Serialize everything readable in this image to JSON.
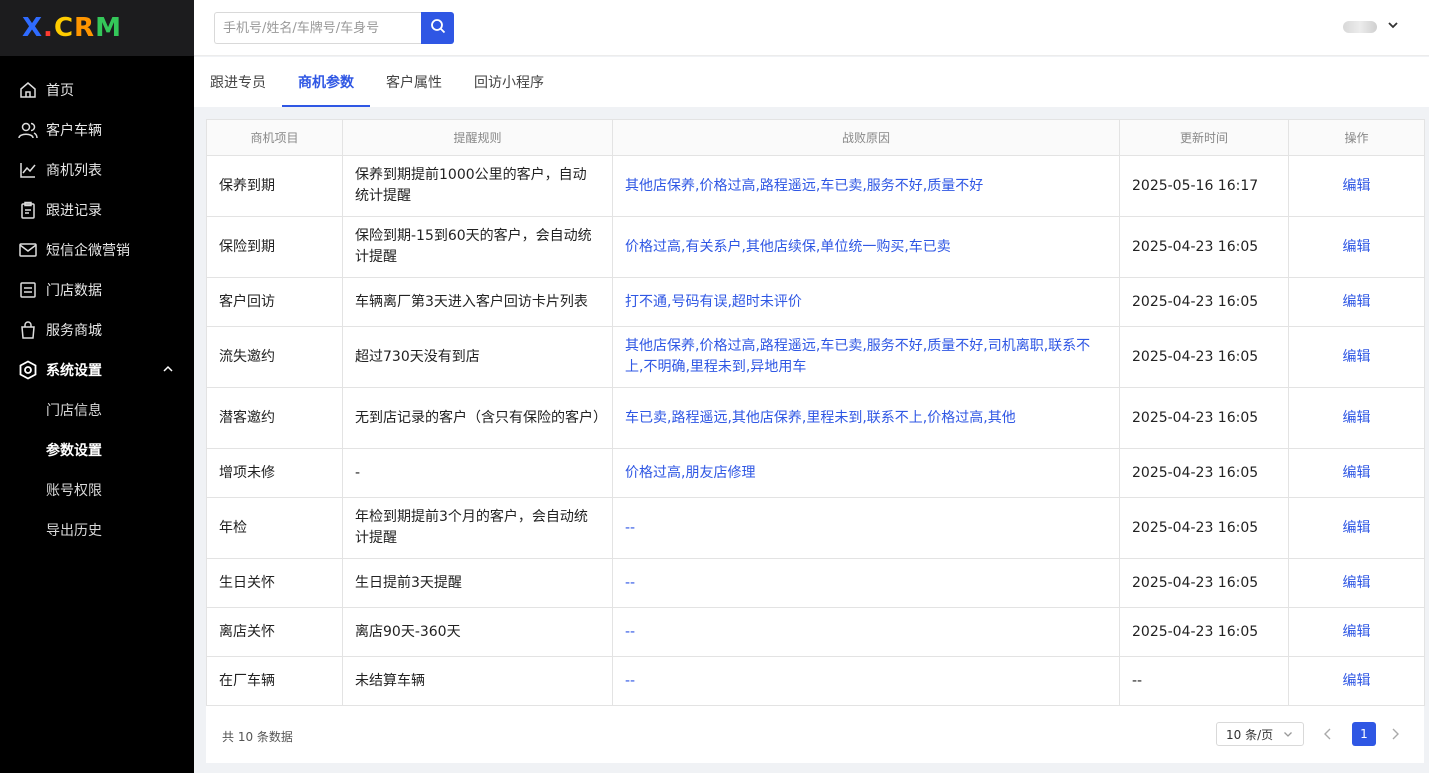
{
  "brand": {
    "logo_parts": [
      "X",
      ".",
      "C",
      "R",
      "M"
    ]
  },
  "sidebar": {
    "items": [
      {
        "label": "首页",
        "icon": "home-icon"
      },
      {
        "label": "客户车辆",
        "icon": "users-icon"
      },
      {
        "label": "商机列表",
        "icon": "chart-line-icon"
      },
      {
        "label": "跟进记录",
        "icon": "clipboard-icon"
      },
      {
        "label": "短信企微营销",
        "icon": "mail-icon"
      },
      {
        "label": "门店数据",
        "icon": "data-list-icon"
      },
      {
        "label": "服务商城",
        "icon": "shopping-bag-icon"
      },
      {
        "label": "系统设置",
        "icon": "settings-icon"
      }
    ],
    "sub_items": [
      {
        "label": "门店信息"
      },
      {
        "label": "参数设置"
      },
      {
        "label": "账号权限"
      },
      {
        "label": "导出历史"
      }
    ]
  },
  "header": {
    "search_placeholder": "手机号/姓名/车牌号/车身号"
  },
  "tabs": [
    {
      "label": "跟进专员"
    },
    {
      "label": "商机参数"
    },
    {
      "label": "客户属性"
    },
    {
      "label": "回访小程序"
    }
  ],
  "table": {
    "headers": [
      "商机项目",
      "提醒规则",
      "战败原因",
      "更新时间",
      "操作"
    ],
    "rows": [
      {
        "item": "保养到期",
        "rule": "保养到期提前1000公里的客户，自动统计提醒",
        "reason": "其他店保养,价格过高,路程遥远,车已卖,服务不好,质量不好",
        "time": "2025-05-16 16:17",
        "op": "编辑"
      },
      {
        "item": "保险到期",
        "rule": "保险到期-15到60天的客户，会自动统计提醒",
        "reason": "价格过高,有关系户,其他店续保,单位统一购买,车已卖",
        "time": "2025-04-23 16:05",
        "op": "编辑"
      },
      {
        "item": "客户回访",
        "rule": "车辆离厂第3天进入客户回访卡片列表",
        "reason": "打不通,号码有误,超时未评价",
        "time": "2025-04-23 16:05",
        "op": "编辑"
      },
      {
        "item": "流失邀约",
        "rule": "超过730天没有到店",
        "reason": "其他店保养,价格过高,路程遥远,车已卖,服务不好,质量不好,司机离职,联系不上,不明确,里程未到,异地用车",
        "time": "2025-04-23 16:05",
        "op": "编辑"
      },
      {
        "item": "潜客邀约",
        "rule": "无到店记录的客户（含只有保险的客户）",
        "reason": "车已卖,路程遥远,其他店保养,里程未到,联系不上,价格过高,其他",
        "time": "2025-04-23 16:05",
        "op": "编辑"
      },
      {
        "item": "增项未修",
        "rule": "-",
        "reason": "价格过高,朋友店修理",
        "time": "2025-04-23 16:05",
        "op": "编辑"
      },
      {
        "item": "年检",
        "rule": "年检到期提前3个月的客户，会自动统计提醒",
        "reason": "--",
        "time": "2025-04-23 16:05",
        "op": "编辑"
      },
      {
        "item": "生日关怀",
        "rule": "生日提前3天提醒",
        "reason": "--",
        "time": "2025-04-23 16:05",
        "op": "编辑"
      },
      {
        "item": "离店关怀",
        "rule": "离店90天-360天",
        "reason": "--",
        "time": "2025-04-23 16:05",
        "op": "编辑"
      },
      {
        "item": "在厂车辆",
        "rule": "未结算车辆",
        "reason": "--",
        "time": "--",
        "op": "编辑"
      }
    ]
  },
  "footer": {
    "total": "共 10 条数据",
    "page_size": "10 条/页",
    "current_page": "1"
  },
  "colors": {
    "accent": "#2f57e4",
    "sidebar_bg": "#000000"
  }
}
